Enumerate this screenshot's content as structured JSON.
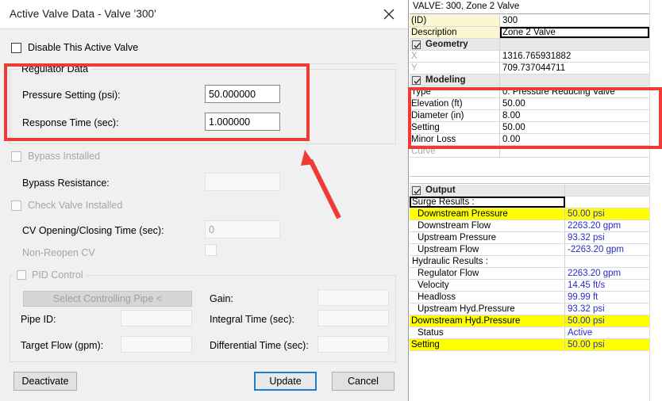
{
  "dialog": {
    "title": "Active Valve Data - Valve '300'",
    "close_icon": "close-icon",
    "disable_checkbox_label": "Disable This Active Valve",
    "regulator_group": {
      "title": "Regulator Data",
      "pressure_setting_label": "Pressure Setting (psi):",
      "pressure_setting_value": "50.000000",
      "response_time_label": "Response Time (sec):",
      "response_time_value": "1.000000"
    },
    "bypass_installed_label": "Bypass Installed",
    "bypass_resistance_label": "Bypass Resistance:",
    "bypass_resistance_value": "",
    "check_valve_installed_label": "Check Valve Installed",
    "cv_time_label": "CV Opening/Closing Time (sec):",
    "cv_time_value": "0",
    "non_reopen_cv_label": "Non-Reopen CV",
    "pid_group": {
      "title": "PID Control",
      "select_pipe_button": "Select Controlling Pipe <",
      "pipe_id_label": "Pipe ID:",
      "pipe_id_value": "",
      "target_flow_label": "Target Flow (gpm):",
      "target_flow_value": "",
      "gain_label": "Gain:",
      "gain_value": "",
      "integral_time_label": "Integral Time (sec):",
      "integral_time_value": "",
      "differential_time_label": "Differential Time (sec):",
      "differential_time_value": ""
    },
    "buttons": {
      "deactivate": "Deactivate",
      "update": "Update",
      "cancel": "Cancel"
    }
  },
  "annotations": {
    "highlight_color": "#f03a35",
    "arrow_color": "#f03a35",
    "boxes": [
      {
        "name": "regulator-data-highlight"
      },
      {
        "name": "modeling-rows-highlight"
      }
    ]
  },
  "panel": {
    "header": "VALVE: 300, Zone 2  Valve",
    "highlight_color": "#ffff00",
    "value_color": "#2b2bc8",
    "rows": [
      {
        "label": "(ID)",
        "value": "300",
        "type": "prop",
        "label_bg": "cream"
      },
      {
        "label": "Description",
        "value": "Zone 2  Valve",
        "type": "prop",
        "label_bg": "cream",
        "editing": true
      },
      {
        "label": "Geometry",
        "value": "",
        "type": "section",
        "checked": true
      },
      {
        "label": "X",
        "value": "1316.765931882",
        "type": "prop",
        "label_dim": true
      },
      {
        "label": "Y",
        "value": "709.737044711",
        "type": "prop",
        "label_dim": true
      },
      {
        "label": "Modeling",
        "value": "",
        "type": "section",
        "checked": true
      },
      {
        "label": "Type",
        "value": "0: Pressure Reducing Valve",
        "type": "prop"
      },
      {
        "label": "Elevation (ft)",
        "value": "50.00",
        "type": "prop"
      },
      {
        "label": "Diameter (in)",
        "value": "8.00",
        "type": "prop"
      },
      {
        "label": "Setting",
        "value": "50.00",
        "type": "prop"
      },
      {
        "label": "Minor Loss",
        "value": "0.00",
        "type": "prop"
      },
      {
        "label": "Curve",
        "value": "",
        "type": "prop",
        "label_dim": true
      }
    ],
    "output_rows": [
      {
        "label": "Output",
        "value": "",
        "type": "section",
        "checked": true
      },
      {
        "label": "Surge Results :",
        "value": "",
        "type": "header",
        "editing": true
      },
      {
        "label": "Downstream Pressure",
        "value": "50.00 psi",
        "type": "result",
        "highlight": true,
        "indent": true
      },
      {
        "label": "Downstream Flow",
        "value": "2263.20 gpm",
        "type": "result",
        "indent": true
      },
      {
        "label": "Upstream Pressure",
        "value": "93.32 psi",
        "type": "result",
        "indent": true
      },
      {
        "label": "Upstream Flow",
        "value": "-2263.20 gpm",
        "type": "result",
        "indent": true
      },
      {
        "label": "Hydraulic Results :",
        "value": "",
        "type": "header"
      },
      {
        "label": "Regulator Flow",
        "value": "2263.20 gpm",
        "type": "result",
        "indent": true
      },
      {
        "label": "Velocity",
        "value": "14.45 ft/s",
        "type": "result",
        "indent": true
      },
      {
        "label": "Headloss",
        "value": "99.99 ft",
        "type": "result",
        "indent": true
      },
      {
        "label": "Upstream Hyd.Pressure",
        "value": "93.32 psi",
        "type": "result",
        "indent": true
      },
      {
        "label": "Downstream Hyd.Pressure",
        "value": "50.00 psi",
        "type": "result",
        "highlight": true
      },
      {
        "label": "Status",
        "value": "Active",
        "type": "result",
        "indent": true
      },
      {
        "label": "Setting",
        "value": "50.00 psi",
        "type": "result",
        "highlight": true
      }
    ]
  }
}
